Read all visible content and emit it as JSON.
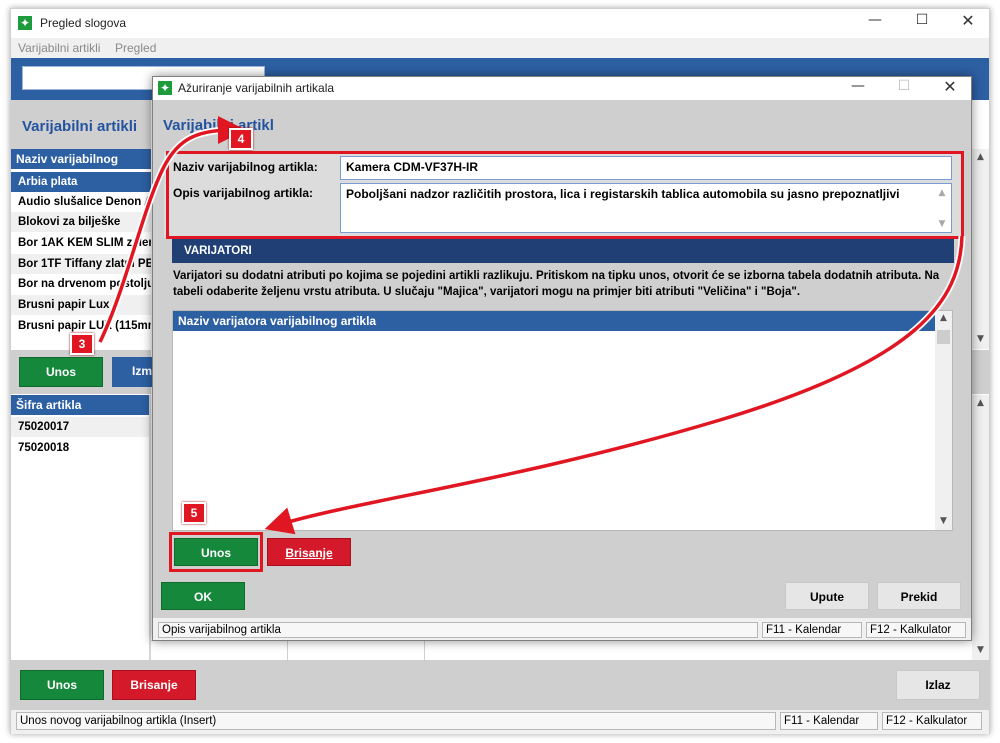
{
  "main_window": {
    "title": "Pregled slogova",
    "menu": [
      "Varijabilni artikli",
      "Pregled"
    ],
    "section_title": "Varijabilni artikli",
    "list_header": "Naziv varijabilnog artikla",
    "list_items": [
      "Arbia plata",
      "Audio slušalice Denon AH",
      "Blokovi za bilješke",
      "Bor 1AK KEM SLIM zelen",
      "Bor 1TF  Tiffany zlatni PE",
      "Bor na drvenom postolju",
      "Brusni papir Lux",
      "Brusni papir LUX (115mm"
    ],
    "buttons": {
      "unos": "Unos",
      "izmjena": "Izm"
    },
    "sku_header": "Šifra artikla",
    "sku_items": [
      "75020017",
      "75020018"
    ],
    "bottom_buttons": {
      "unos": "Unos",
      "brisanje": "Brisanje",
      "izlaz": "Izlaz"
    },
    "status": {
      "text": "Unos novog varijabilnog artikla (Insert)",
      "f11": "F11 - Kalendar",
      "f12": "F12 - Kalkulator"
    }
  },
  "dialog": {
    "title": "Ažuriranje varijabilnih artikala",
    "section_title": "Varijabilni artikl",
    "name_label": "Naziv varijabilnog artikla:",
    "name_value": "Kamera CDM-VF37H-IR",
    "desc_label": "Opis varijabilnog artikla:",
    "desc_value": "Poboljšani nadzor različitih prostora, lica i registarskih tablica automobila su jasno prepoznatljivi",
    "variators_header": "VARIJATORI",
    "variators_info": "Varijatori su dodatni atributi po kojima se pojedini artikli razlikuju. Pritiskom na tipku unos, otvorit će se izborna tabela dodatnih atributa. Na tabeli odaberite željenu vrstu atributa. U slučaju \"Majica\", varijatori mogu na primjer biti atributi \"Veličina\" i \"Boja\".",
    "variators_table_header": "Naziv varijatora varijabilnog artikla",
    "buttons": {
      "unos": "Unos",
      "brisanje": "Brisanje",
      "ok": "OK",
      "upute": "Upute",
      "prekid": "Prekid"
    },
    "status": {
      "text": "Opis varijabilnog artikla",
      "f11": "F11 - Kalendar",
      "f12": "F12 - Kalkulator"
    }
  },
  "annotations": {
    "step3": "3",
    "step4": "4",
    "step5": "5"
  },
  "colors": {
    "brand_blue": "#2d5fa3",
    "green": "#16883c",
    "red": "#d41a2a",
    "annotation_red": "#e01722"
  }
}
